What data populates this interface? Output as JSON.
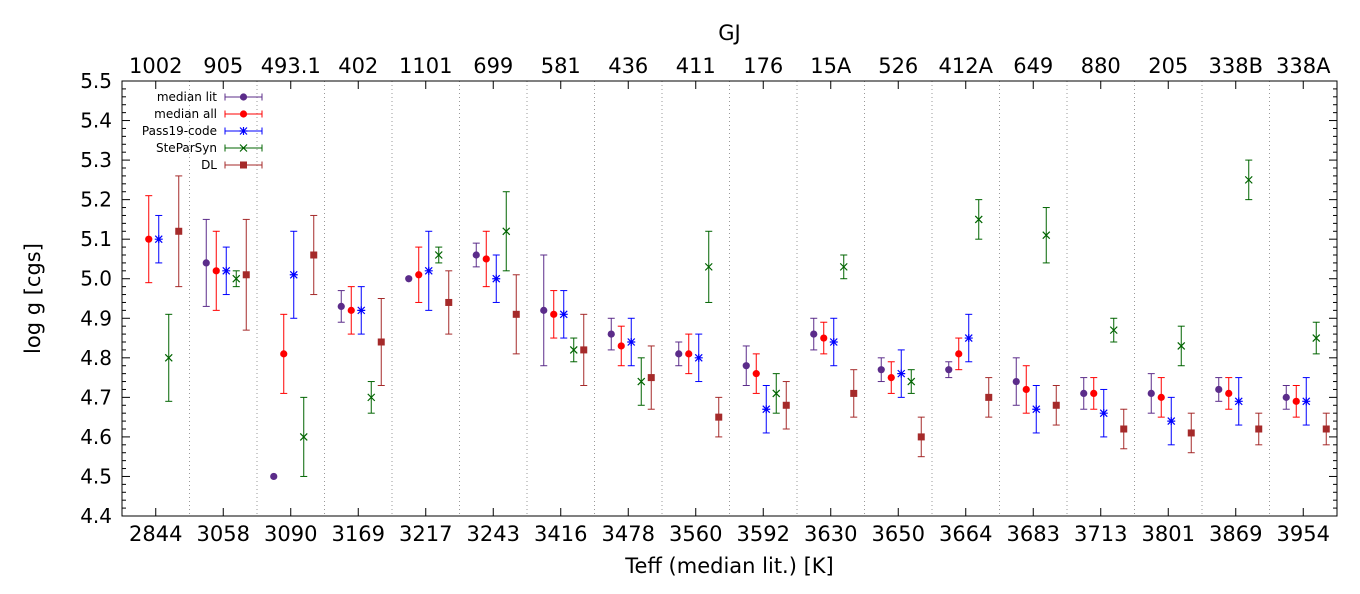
{
  "chart_data": {
    "type": "scatter",
    "title": "",
    "top_axis_label": "GJ",
    "xlabel": "Teff (median lit.) [K]",
    "ylabel": "log g [cgs]",
    "ylim": [
      4.4,
      5.5
    ],
    "yticks": [
      "4.4",
      "4.5",
      "4.6",
      "4.7",
      "4.8",
      "4.9",
      "5.0",
      "5.1",
      "5.2",
      "5.3",
      "5.4",
      "5.5"
    ],
    "categories": [
      "2844",
      "3058",
      "3090",
      "3169",
      "3217",
      "3243",
      "3416",
      "3478",
      "3560",
      "3592",
      "3630",
      "3650",
      "3664",
      "3683",
      "3713",
      "3801",
      "3869",
      "3954"
    ],
    "top_categories": [
      "1002",
      "905",
      "493.1",
      "402",
      "1101",
      "699",
      "581",
      "436",
      "411",
      "176",
      "15A",
      "526",
      "412A",
      "649",
      "880",
      "205",
      "338B",
      "338A"
    ],
    "grid": "vertical dotted separators between stars",
    "legend_position": "top-left",
    "series": [
      {
        "name": "median lit",
        "color": "#5b2c8a",
        "marker": "circle",
        "values": [
          null,
          5.04,
          4.5,
          4.93,
          5.0,
          5.06,
          4.92,
          4.86,
          4.81,
          4.78,
          4.86,
          4.77,
          4.77,
          4.74,
          4.71,
          4.71,
          4.72,
          4.7
        ],
        "err": [
          null,
          0.11,
          0,
          0.04,
          0,
          0.03,
          0.14,
          0.04,
          0.03,
          0.05,
          0.04,
          0.03,
          0.02,
          0.06,
          0.04,
          0.05,
          0.03,
          0.03
        ]
      },
      {
        "name": "median all",
        "color": "#ff0000",
        "marker": "circle",
        "values": [
          5.1,
          5.02,
          4.81,
          4.92,
          5.01,
          5.05,
          4.91,
          4.83,
          4.81,
          4.76,
          4.85,
          4.75,
          4.81,
          4.72,
          4.71,
          4.7,
          4.71,
          4.69
        ],
        "err": [
          0.11,
          0.1,
          0.1,
          0.06,
          0.07,
          0.07,
          0.06,
          0.05,
          0.05,
          0.05,
          0.04,
          0.04,
          0.04,
          0.06,
          0.04,
          0.05,
          0.04,
          0.04
        ]
      },
      {
        "name": "Pass19-code",
        "color": "#0000ff",
        "marker": "star",
        "values": [
          5.1,
          5.02,
          5.01,
          4.92,
          5.02,
          5.0,
          4.91,
          4.84,
          4.8,
          4.67,
          4.84,
          4.76,
          4.85,
          4.67,
          4.66,
          4.64,
          4.69,
          4.69
        ],
        "err": [
          0.06,
          0.06,
          0.11,
          0.06,
          0.1,
          0.06,
          0.06,
          0.06,
          0.06,
          0.06,
          0.06,
          0.06,
          0.06,
          0.06,
          0.06,
          0.06,
          0.06,
          0.06
        ]
      },
      {
        "name": "SteParSyn",
        "color": "#006400",
        "marker": "x",
        "values": [
          4.8,
          5.0,
          4.6,
          4.7,
          5.06,
          5.12,
          4.82,
          4.74,
          5.03,
          4.71,
          5.03,
          4.74,
          5.15,
          5.11,
          4.87,
          4.83,
          5.25,
          4.85
        ],
        "err": [
          0.11,
          0.02,
          0.1,
          0.04,
          0.02,
          0.1,
          0.03,
          0.06,
          0.09,
          0.05,
          0.03,
          0.03,
          0.05,
          0.07,
          0.03,
          0.05,
          0.05,
          0.04
        ]
      },
      {
        "name": "DL",
        "color": "#a52a2a",
        "marker": "square",
        "values": [
          5.12,
          5.01,
          5.06,
          4.84,
          4.94,
          4.91,
          4.82,
          4.75,
          4.65,
          4.68,
          4.71,
          4.6,
          4.7,
          4.68,
          4.62,
          4.61,
          4.62,
          4.62
        ],
        "err": [
          0.14,
          0.14,
          0.1,
          0.11,
          0.08,
          0.1,
          0.09,
          0.08,
          0.05,
          0.06,
          0.06,
          0.05,
          0.05,
          0.05,
          0.05,
          0.05,
          0.04,
          0.04
        ]
      }
    ]
  }
}
